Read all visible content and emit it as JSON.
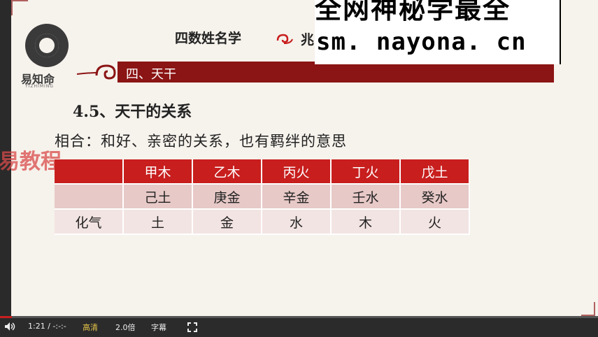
{
  "overlay": {
    "top_text": "全网神秘学最全",
    "url": "sm. nayona. cn"
  },
  "logo": {
    "brand": "易知命",
    "sub": "YIZHIMING"
  },
  "header": {
    "title": "四数姓名学",
    "title_tail": "兆"
  },
  "section": {
    "label": "四、天干"
  },
  "content": {
    "heading": "4.5、天干的关系",
    "description": "相合：和好、亲密的关系，也有羁绊的意思",
    "watermark": "易教程"
  },
  "table": {
    "headers": [
      "",
      "甲木",
      "乙木",
      "丙火",
      "丁火",
      "戊土"
    ],
    "rows": [
      [
        "",
        "己土",
        "庚金",
        "辛金",
        "壬水",
        "癸水"
      ],
      [
        "化气",
        "土",
        "金",
        "水",
        "木",
        "火"
      ]
    ]
  },
  "player": {
    "time": "1:21 / -:-:-",
    "quality": "高清",
    "speed": "2.0倍",
    "subtitles": "字幕",
    "progress_fraction": 0.02
  },
  "colors": {
    "accent_red": "#c81e1e",
    "dark_red": "#8b1414",
    "quality_yellow": "#e6c54a"
  }
}
